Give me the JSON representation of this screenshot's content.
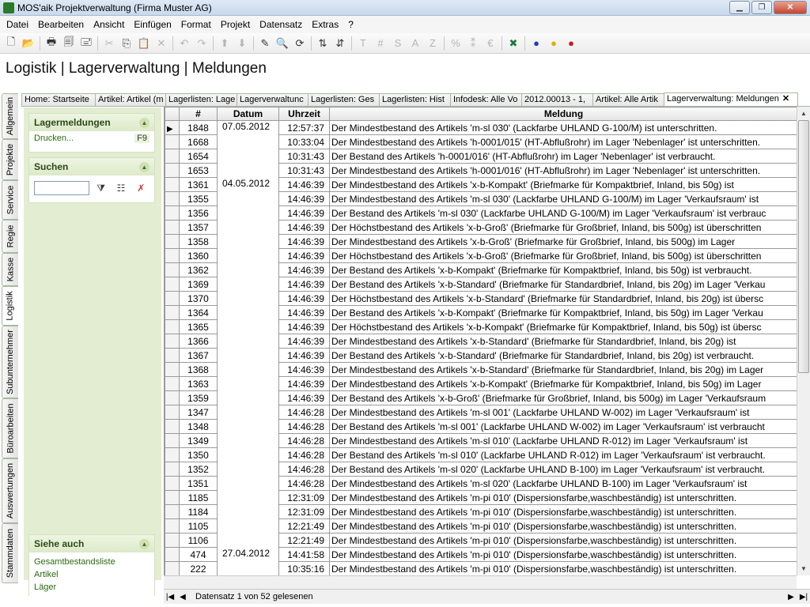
{
  "window": {
    "title": "MOS'aik Projektverwaltung (Firma Muster AG)"
  },
  "menu": [
    "Datei",
    "Bearbeiten",
    "Ansicht",
    "Einfügen",
    "Format",
    "Projekt",
    "Datensatz",
    "Extras",
    "?"
  ],
  "page_title": "Logistik | Lagerverwaltung | Meldungen",
  "vertical_tabs": [
    "Allgemein",
    "Projekte",
    "Service",
    "Regie",
    "Kasse",
    "Logistik",
    "Subunternehmer",
    "Büroarbeiten",
    "Auswertungen",
    "Stammdaten"
  ],
  "active_vertical_tab": "Logistik",
  "tabs": [
    "Home: Startseite",
    "Artikel: Artikel (m",
    "Lagerlisten: Lage",
    "Lagerverwaltunc",
    "Lagerlisten: Ges",
    "Lagerlisten: Hist",
    "Infodesk: Alle Vo",
    "2012.00013 - 1,",
    "Artikel: Alle Artik",
    "Lagerverwaltung: Meldungen"
  ],
  "sidebar": {
    "lagermeldungen": {
      "title": "Lagermeldungen",
      "item": "Drucken...",
      "shortcut": "F9"
    },
    "suchen": {
      "title": "Suchen",
      "placeholder": ""
    },
    "siehe_auch": {
      "title": "Siehe auch",
      "links": [
        "Gesamtbestandsliste",
        "Artikel",
        "Läger"
      ]
    }
  },
  "grid": {
    "columns": [
      "#",
      "Datum",
      "Uhrzeit",
      "Meldung"
    ],
    "rows": [
      {
        "id": "1848",
        "date": "07.05.2012",
        "time": "12:57:37",
        "msg": "Der Mindestbestand des Artikels 'm-sl 030' (Lackfarbe UHLAND G-100/M) ist unterschritten."
      },
      {
        "id": "1668",
        "date": "",
        "time": "10:33:04",
        "msg": "Der Mindestbestand des Artikels 'h-0001/015' (HT-Abflußrohr) im Lager 'Nebenlager' ist unterschritten."
      },
      {
        "id": "1654",
        "date": "",
        "time": "10:31:43",
        "msg": "Der Bestand des Artikels 'h-0001/016' (HT-Abflußrohr) im Lager 'Nebenlager' ist verbraucht."
      },
      {
        "id": "1653",
        "date": "",
        "time": "10:31:43",
        "msg": "Der Mindestbestand des Artikels 'h-0001/016' (HT-Abflußrohr) im Lager 'Nebenlager' ist unterschritten."
      },
      {
        "id": "1361",
        "date": "04.05.2012",
        "time": "14:46:39",
        "msg": "Der Mindestbestand des Artikels 'x-b-Kompakt' (Briefmarke für Kompaktbrief, Inland, bis 50g) ist"
      },
      {
        "id": "1355",
        "date": "",
        "time": "14:46:39",
        "msg": "Der Mindestbestand des Artikels 'm-sl 030' (Lackfarbe UHLAND G-100/M) im Lager 'Verkaufsraum' ist"
      },
      {
        "id": "1356",
        "date": "",
        "time": "14:46:39",
        "msg": "Der Bestand des Artikels 'm-sl 030' (Lackfarbe UHLAND G-100/M) im Lager 'Verkaufsraum' ist verbrauc"
      },
      {
        "id": "1357",
        "date": "",
        "time": "14:46:39",
        "msg": "Der Höchstbestand des Artikels 'x-b-Groß' (Briefmarke für Großbrief, Inland, bis 500g) ist überschritten"
      },
      {
        "id": "1358",
        "date": "",
        "time": "14:46:39",
        "msg": "Der Mindestbestand des Artikels 'x-b-Groß' (Briefmarke für Großbrief, Inland, bis 500g) im Lager"
      },
      {
        "id": "1360",
        "date": "",
        "time": "14:46:39",
        "msg": "Der Höchstbestand des Artikels 'x-b-Groß' (Briefmarke für Großbrief, Inland, bis 500g) ist überschritten"
      },
      {
        "id": "1362",
        "date": "",
        "time": "14:46:39",
        "msg": "Der Bestand des Artikels 'x-b-Kompakt' (Briefmarke für Kompaktbrief, Inland, bis 50g) ist verbraucht."
      },
      {
        "id": "1369",
        "date": "",
        "time": "14:46:39",
        "msg": "Der Bestand des Artikels 'x-b-Standard' (Briefmarke für Standardbrief, Inland, bis 20g) im Lager 'Verkau"
      },
      {
        "id": "1370",
        "date": "",
        "time": "14:46:39",
        "msg": "Der Höchstbestand des Artikels 'x-b-Standard' (Briefmarke für Standardbrief, Inland, bis 20g) ist übersc"
      },
      {
        "id": "1364",
        "date": "",
        "time": "14:46:39",
        "msg": "Der Bestand des Artikels 'x-b-Kompakt' (Briefmarke für Kompaktbrief, Inland, bis 50g) im Lager 'Verkau"
      },
      {
        "id": "1365",
        "date": "",
        "time": "14:46:39",
        "msg": "Der Höchstbestand des Artikels 'x-b-Kompakt' (Briefmarke für Kompaktbrief, Inland, bis 50g) ist übersc"
      },
      {
        "id": "1366",
        "date": "",
        "time": "14:46:39",
        "msg": "Der Mindestbestand des Artikels 'x-b-Standard' (Briefmarke für Standardbrief, Inland, bis 20g) ist"
      },
      {
        "id": "1367",
        "date": "",
        "time": "14:46:39",
        "msg": "Der Bestand des Artikels 'x-b-Standard' (Briefmarke für Standardbrief, Inland, bis 20g) ist verbraucht."
      },
      {
        "id": "1368",
        "date": "",
        "time": "14:46:39",
        "msg": "Der Mindestbestand des Artikels 'x-b-Standard' (Briefmarke für Standardbrief, Inland, bis 20g) im Lager"
      },
      {
        "id": "1363",
        "date": "",
        "time": "14:46:39",
        "msg": "Der Mindestbestand des Artikels 'x-b-Kompakt' (Briefmarke für Kompaktbrief, Inland, bis 50g) im Lager"
      },
      {
        "id": "1359",
        "date": "",
        "time": "14:46:39",
        "msg": "Der Bestand des Artikels 'x-b-Groß' (Briefmarke für Großbrief, Inland, bis 500g) im Lager 'Verkaufsraum"
      },
      {
        "id": "1347",
        "date": "",
        "time": "14:46:28",
        "msg": "Der Mindestbestand des Artikels 'm-sl 001' (Lackfarbe UHLAND W-002) im Lager 'Verkaufsraum' ist"
      },
      {
        "id": "1348",
        "date": "",
        "time": "14:46:28",
        "msg": "Der Bestand des Artikels 'm-sl 001' (Lackfarbe UHLAND W-002) im Lager 'Verkaufsraum' ist verbraucht"
      },
      {
        "id": "1349",
        "date": "",
        "time": "14:46:28",
        "msg": "Der Mindestbestand des Artikels 'm-sl 010' (Lackfarbe UHLAND R-012) im Lager 'Verkaufsraum' ist"
      },
      {
        "id": "1350",
        "date": "",
        "time": "14:46:28",
        "msg": "Der Bestand des Artikels 'm-sl 010' (Lackfarbe UHLAND R-012) im Lager 'Verkaufsraum' ist verbraucht."
      },
      {
        "id": "1352",
        "date": "",
        "time": "14:46:28",
        "msg": "Der Bestand des Artikels 'm-sl 020' (Lackfarbe UHLAND B-100) im Lager 'Verkaufsraum' ist verbraucht."
      },
      {
        "id": "1351",
        "date": "",
        "time": "14:46:28",
        "msg": "Der Mindestbestand des Artikels 'm-sl 020' (Lackfarbe UHLAND B-100) im Lager 'Verkaufsraum' ist"
      },
      {
        "id": "1185",
        "date": "",
        "time": "12:31:09",
        "msg": "Der Mindestbestand des Artikels 'm-pi 010' (Dispersionsfarbe,waschbeständig) ist unterschritten."
      },
      {
        "id": "1184",
        "date": "",
        "time": "12:31:09",
        "msg": "Der Mindestbestand des Artikels 'm-pi 010' (Dispersionsfarbe,waschbeständig) ist unterschritten."
      },
      {
        "id": "1105",
        "date": "",
        "time": "12:21:49",
        "msg": "Der Mindestbestand des Artikels 'm-pi 010' (Dispersionsfarbe,waschbeständig) ist unterschritten."
      },
      {
        "id": "1106",
        "date": "",
        "time": "12:21:49",
        "msg": "Der Mindestbestand des Artikels 'm-pi 010' (Dispersionsfarbe,waschbeständig) ist unterschritten."
      },
      {
        "id": "474",
        "date": "27.04.2012",
        "time": "14:41:58",
        "msg": "Der Mindestbestand des Artikels 'm-pi 010' (Dispersionsfarbe,waschbeständig) ist unterschritten."
      },
      {
        "id": "222",
        "date": "",
        "time": "10:35:16",
        "msg": "Der Mindestbestand des Artikels 'm-pi 010' (Dispersionsfarbe,waschbeständig) ist unterschritten."
      }
    ]
  },
  "status": {
    "text": "Datensatz 1 von 52 gelesenen"
  },
  "colors": {
    "panel_bg": "#e3edd2",
    "panel_head_text": "#2c4a18",
    "link": "#2c6a10"
  }
}
